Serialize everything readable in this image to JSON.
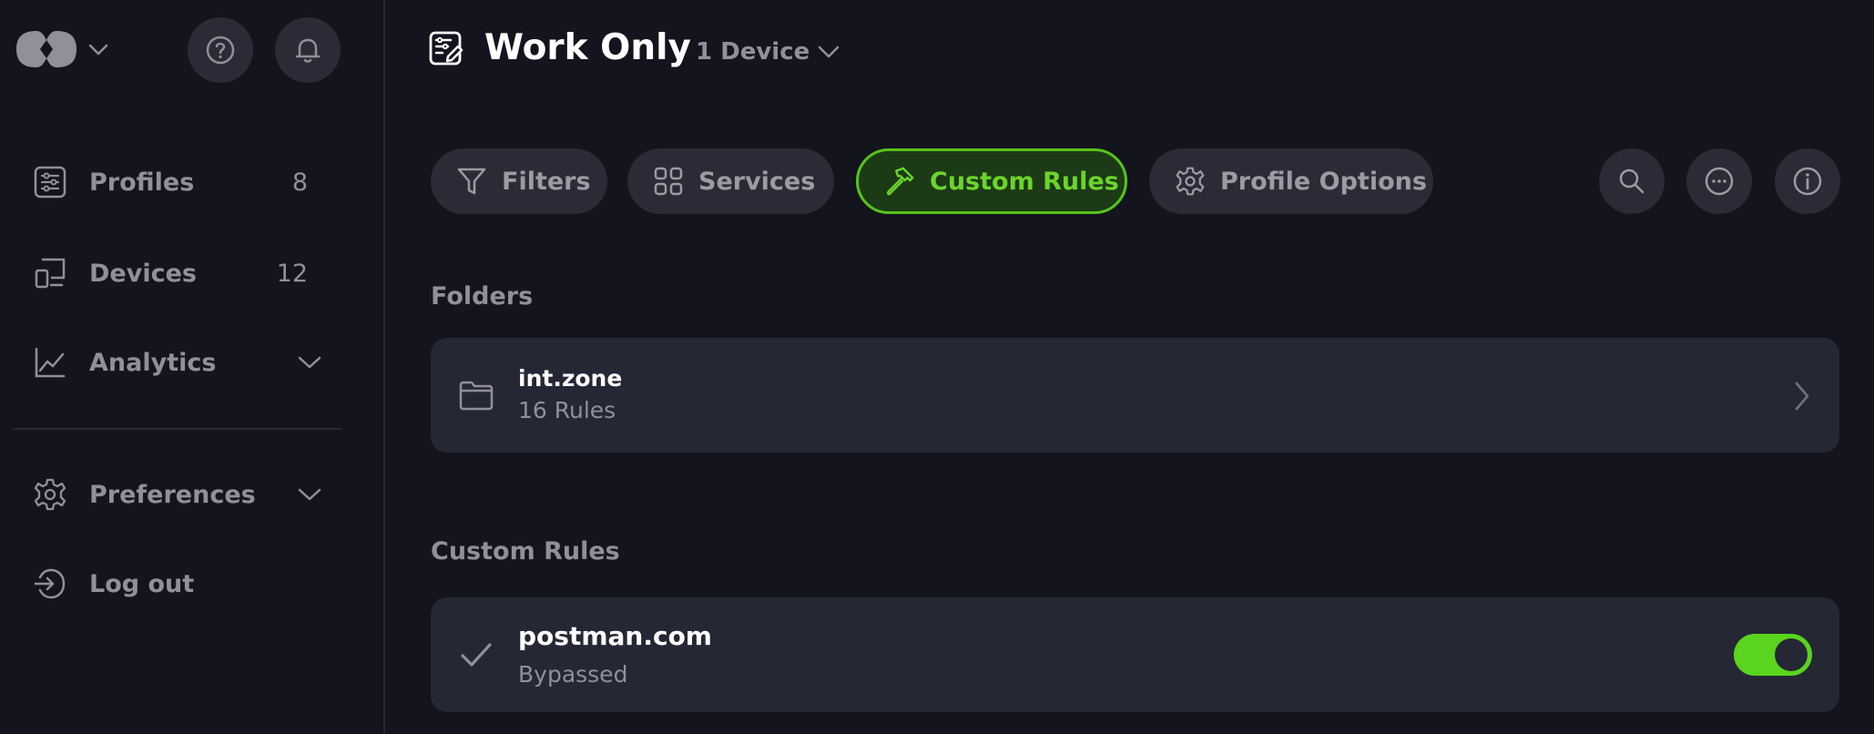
{
  "sidebar": {
    "items": [
      {
        "label": "Profiles",
        "count": "8"
      },
      {
        "label": "Devices",
        "count": "12"
      },
      {
        "label": "Analytics"
      },
      {
        "label": "Preferences"
      },
      {
        "label": "Log out"
      }
    ]
  },
  "header": {
    "title": "Work Only",
    "device_selector": "1 Device"
  },
  "tabs": [
    {
      "label": "Filters",
      "active": false
    },
    {
      "label": "Services",
      "active": false
    },
    {
      "label": "Custom Rules",
      "active": true
    },
    {
      "label": "Profile Options",
      "active": false
    }
  ],
  "sections": {
    "folders_title": "Folders",
    "rules_title": "Custom Rules"
  },
  "folders": [
    {
      "name": "int.zone",
      "count": "16 Rules"
    }
  ],
  "rules": [
    {
      "domain": "postman.com",
      "status": "Bypassed",
      "enabled": true
    }
  ],
  "colors": {
    "background": "#13141d",
    "card": "#252735",
    "button": "#2a2b36",
    "accent": "#5ad41c",
    "active_tab_bg": "#1d3a16",
    "muted_text": "#8f909a"
  },
  "icons": [
    "logo-icon",
    "help-icon",
    "bell-icon",
    "profiles-icon",
    "devices-icon",
    "analytics-icon",
    "gear-icon",
    "logout-icon",
    "profile-edit-icon",
    "filter-icon",
    "grid-icon",
    "hammer-icon",
    "search-icon",
    "more-icon",
    "info-icon",
    "folder-icon",
    "check-icon",
    "chevron-right-icon",
    "chevron-down-icon"
  ]
}
